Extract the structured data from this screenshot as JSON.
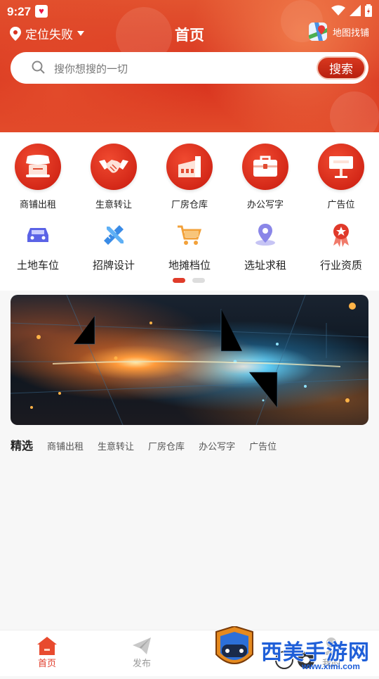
{
  "status": {
    "time": "9:27"
  },
  "header": {
    "location": "定位失败",
    "title": "首页",
    "map_find": "地图找铺"
  },
  "search": {
    "placeholder": "搜你想搜的一切",
    "button": "搜索"
  },
  "categories_primary": [
    {
      "label": "商铺出租",
      "icon": "shop-icon"
    },
    {
      "label": "生意转让",
      "icon": "handshake-icon"
    },
    {
      "label": "厂房仓库",
      "icon": "factory-icon"
    },
    {
      "label": "办公写字",
      "icon": "briefcase-icon"
    },
    {
      "label": "广告位",
      "icon": "billboard-icon"
    }
  ],
  "categories_secondary": [
    {
      "label": "土地车位",
      "icon": "car-icon",
      "color": "#5b63e6"
    },
    {
      "label": "招牌设计",
      "icon": "ruler-pencil-icon",
      "color": "#3a8be6"
    },
    {
      "label": "地摊档位",
      "icon": "cart-icon",
      "color": "#f2a13a"
    },
    {
      "label": "选址求租",
      "icon": "location-pin-icon",
      "color": "#8a86e8"
    },
    {
      "label": "行业资质",
      "icon": "award-icon",
      "color": "#e0392a"
    }
  ],
  "carousel": {
    "pages": 2,
    "active": 1
  },
  "tabs": {
    "selected": "精选",
    "items": [
      "商铺出租",
      "生意转让",
      "厂房仓库",
      "办公写字",
      "广告位"
    ]
  },
  "bottom_nav": [
    {
      "label": "首页",
      "icon": "home-icon",
      "active": true
    },
    {
      "label": "发布",
      "icon": "paper-plane-icon",
      "active": false
    },
    {
      "label": "我的",
      "icon": "user-icon",
      "active": false
    }
  ],
  "watermark": {
    "text": "西美手游网",
    "url": "www.ximi.com"
  },
  "colors": {
    "primary": "#e03c2a",
    "inactive": "#999999"
  }
}
